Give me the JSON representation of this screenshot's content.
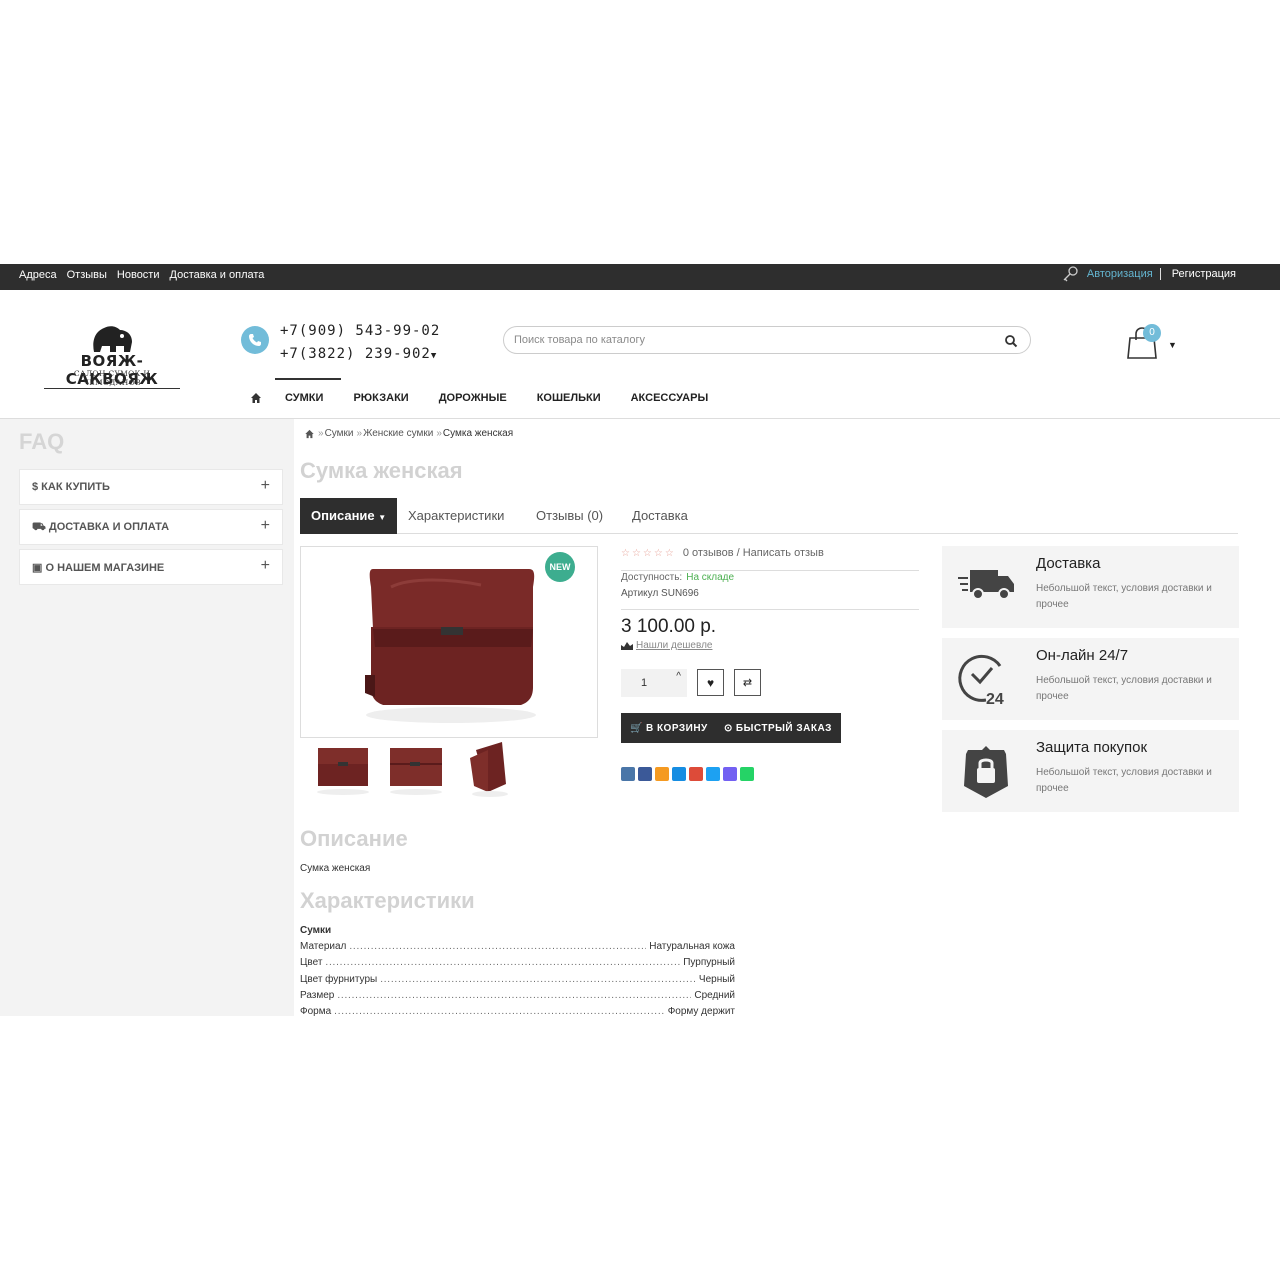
{
  "topbar": {
    "links": [
      "Адреса",
      "Отзывы",
      "Новости",
      "Доставка и оплата"
    ],
    "login": "Авторизация",
    "register": "Регистрация"
  },
  "logo": {
    "title": "ВОЯЖ-САКВОЯЖ",
    "subtitle": "САЛОН СУМОК И ЧЕМОДАНОВ"
  },
  "phones": [
    "+7(909) 543-99-02",
    "+7(3822) 239-902"
  ],
  "search": {
    "placeholder": "Поиск товара по каталогу"
  },
  "cart": {
    "count": "0"
  },
  "nav": [
    "СУМКИ",
    "РЮКЗАКИ",
    "ДОРОЖНЫЕ",
    "КОШЕЛЬКИ",
    "АКСЕССУАРЫ"
  ],
  "sidebar": {
    "title": "FAQ",
    "items": [
      {
        "icon": "dollar-icon",
        "label": "$ КАК КУПИТЬ"
      },
      {
        "icon": "truck-icon",
        "label": "ДОСТАВКА И ОПЛАТА"
      },
      {
        "icon": "gift-icon",
        "label": "О НАШЕМ МАГАЗИНЕ"
      }
    ]
  },
  "breadcrumb": [
    "Сумки",
    "Женские сумки",
    "Сумка женская"
  ],
  "product": {
    "title": "Сумка женская",
    "tabs": [
      "Описание",
      "Характеристики",
      "Отзывы (0)",
      "Доставка"
    ],
    "badge": "NEW",
    "reviews_link": "0 отзывов / Написать отзыв",
    "availability_label": "Доступность:",
    "availability_value": "На складе",
    "sku": "Артикул SUN696",
    "price": "3 100.00 р.",
    "cheaper": "Нашли дешевле",
    "quantity": "1",
    "add_to_cart": "В КОРЗИНУ",
    "quick_order": "БЫСТРЫЙ ЗАКАЗ",
    "rating": 0
  },
  "info_blocks": [
    {
      "icon": "delivery-truck-icon",
      "title": "Доставка",
      "text": "Небольшой текст, условия доставки и прочее"
    },
    {
      "icon": "clock-24-icon",
      "title": "Он-лайн 24/7",
      "text": "Небольшой текст, условия доставки и прочее"
    },
    {
      "icon": "shield-lock-icon",
      "title": "Защита покупок",
      "text": "Небольшой текст, условия доставки и прочее"
    }
  ],
  "description": {
    "heading": "Описание",
    "text": "Сумка женская"
  },
  "specs": {
    "heading": "Характеристики",
    "group": "Сумки",
    "rows": [
      {
        "key": "Материал",
        "value": "Натуральная кожа"
      },
      {
        "key": "Цвет",
        "value": "Пурпурный"
      },
      {
        "key": "Цвет фурнитуры",
        "value": "Черный"
      },
      {
        "key": "Размер",
        "value": "Средний"
      },
      {
        "key": "Форма",
        "value": "Форму держит"
      }
    ]
  },
  "colors": {
    "accent": "#72bcd9",
    "dark": "#2e2e2e",
    "new_badge": "#3dad8f",
    "in_stock": "#4caf50"
  }
}
